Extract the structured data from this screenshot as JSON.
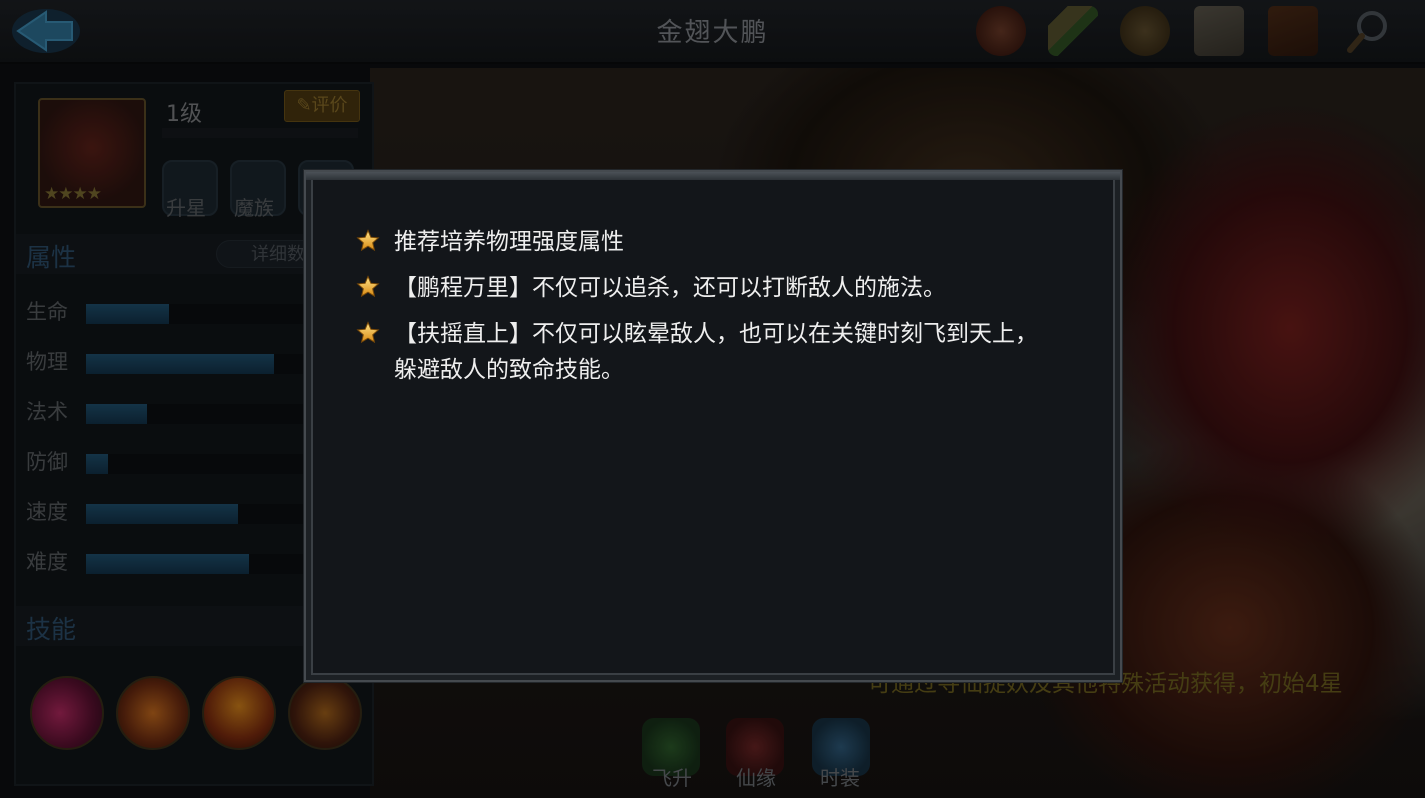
{
  "header": {
    "title": "金翅大鹏",
    "icons": [
      "challenge-seal-icon",
      "scroll-icon",
      "medal-coin-icon",
      "notice-paper-icon",
      "handbook-icon",
      "search-magnifier-icon"
    ]
  },
  "hero": {
    "level": "1级",
    "rate_label": "评价",
    "stars": 4,
    "badges": [
      "升星",
      "魔族"
    ]
  },
  "attributes": {
    "title": "属性",
    "detail_label": "详细数",
    "stats": [
      {
        "label": "生命",
        "value": 0.3
      },
      {
        "label": "物理",
        "value": 0.68
      },
      {
        "label": "法术",
        "value": 0.22
      },
      {
        "label": "防御",
        "value": 0.08
      },
      {
        "label": "速度",
        "value": 0.55
      },
      {
        "label": "难度",
        "value": 0.59
      }
    ]
  },
  "skills": {
    "title": "技能"
  },
  "bottom_tabs": [
    "飞升",
    "仙缘",
    "时装"
  ],
  "hint": "可通过寻仙捉妖及其他特殊活动获得，初始4星",
  "dialog": {
    "tips": [
      "推荐培养物理强度属性",
      "【鹏程万里】不仅可以追杀，还可以打断敌人的施法。",
      "【扶摇直上】不仅可以眩晕敌人，也可以在关键时刻飞到天上，躲避敌人的致命技能。"
    ]
  }
}
